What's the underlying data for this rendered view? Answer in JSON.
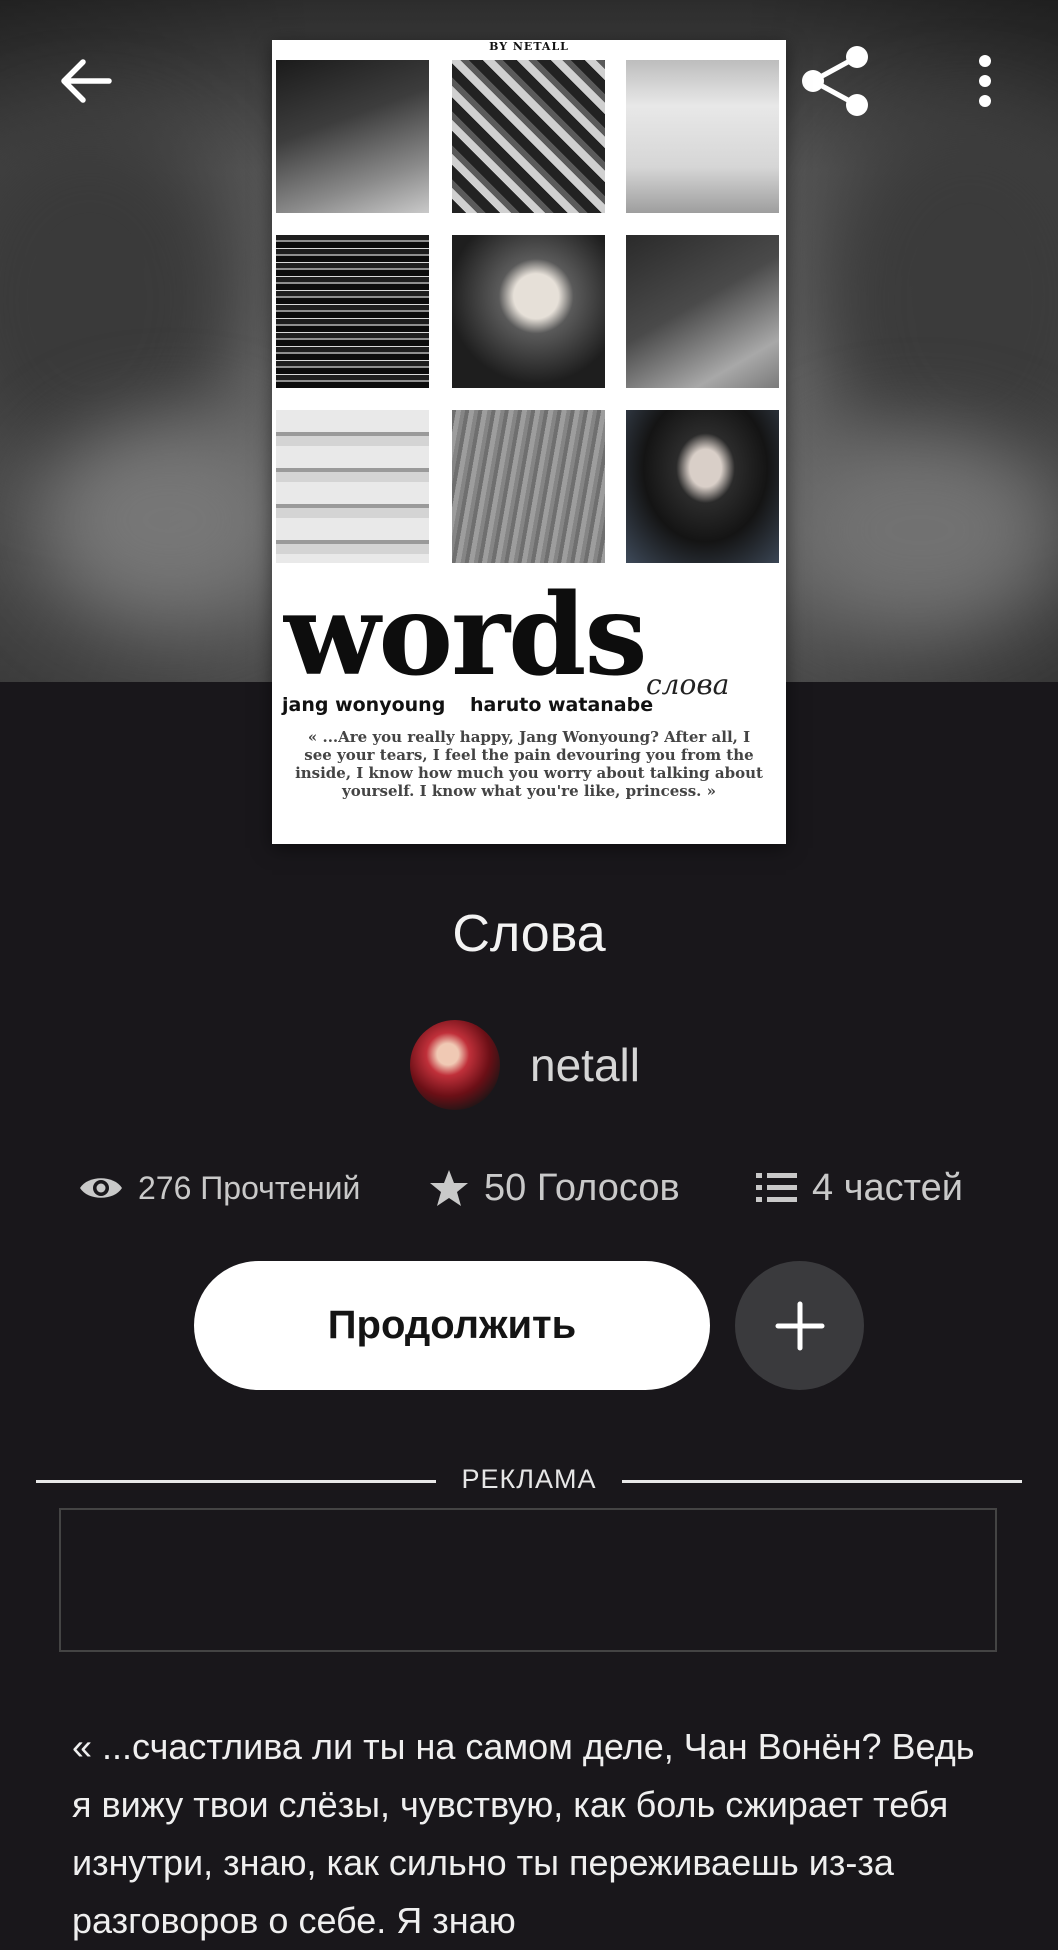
{
  "cover": {
    "byline": "BY NETALL",
    "title": "words",
    "script_title": "слова",
    "names": [
      "jang wonyoung",
      "haruto watanabe"
    ],
    "quote": "« ...Are you really happy, Jang Wonyoung? After all, I see your tears, I feel the pain devouring you from the inside, I know how much you worry about talking about yourself. I know what you're like, princess. »"
  },
  "story": {
    "title": "Слова",
    "author": "netall"
  },
  "stats": {
    "reads": "276 Прочтений",
    "votes": "50 Голосов",
    "parts": "4 частей"
  },
  "actions": {
    "continue_label": "Продолжить"
  },
  "ad": {
    "label": "РЕКЛАМА"
  },
  "description": "« ...счастлива ли ты на самом деле, Чан Вонён? Ведь я вижу твои слёзы, чувствую, как боль сжирает тебя изнутри, знаю, как сильно ты переживаешь из-за разговоров о себе. Я знаю",
  "icons": {
    "back": "arrow-left-icon",
    "share": "share-icon",
    "more": "more-vertical-icon",
    "reads": "eye-icon",
    "votes": "star-icon",
    "parts": "list-icon",
    "add": "plus-icon"
  }
}
